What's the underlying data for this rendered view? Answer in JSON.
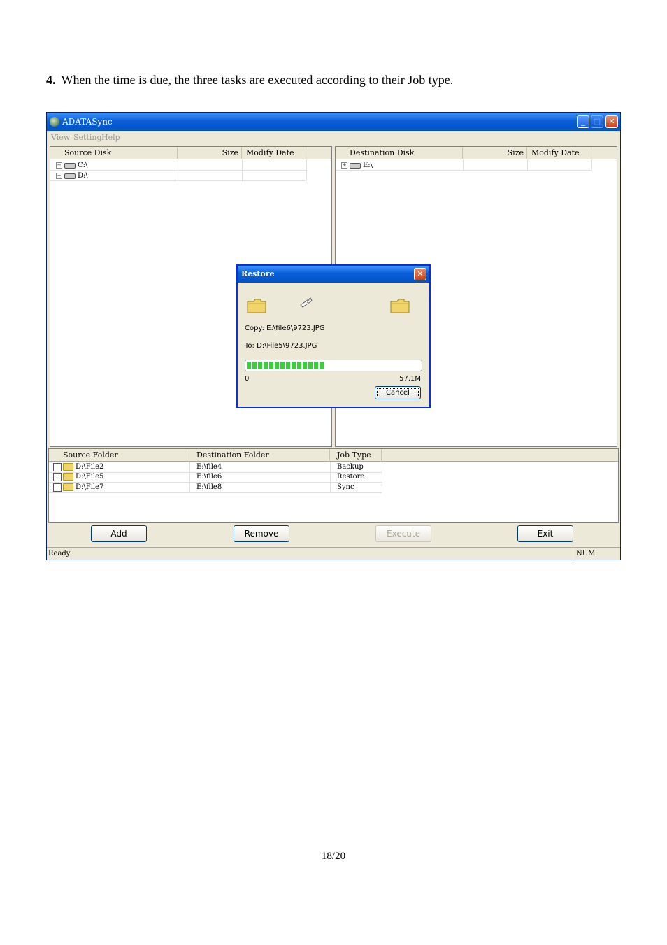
{
  "doc": {
    "step_number": "4.",
    "step_text": "When the time is due, the three tasks are executed according to their Job type.",
    "page_number": "18/20"
  },
  "window": {
    "title": "ADATASync",
    "menu": [
      "View",
      "Setting",
      "Help"
    ],
    "source_pane": {
      "columns": [
        "Source Disk",
        "Size",
        "Modify Date"
      ],
      "items": [
        "C:\\",
        "D:\\"
      ]
    },
    "dest_pane": {
      "columns": [
        "Destination Disk",
        "Size",
        "Modify Date"
      ],
      "items": [
        "E:\\"
      ]
    },
    "jobs": {
      "columns": [
        "Source Folder",
        "Destination Folder",
        "Job Type"
      ],
      "rows": [
        {
          "source": "D:\\File2",
          "dest": "E:\\file4",
          "type": "Backup"
        },
        {
          "source": "D:\\File5",
          "dest": "E:\\file6",
          "type": "Restore"
        },
        {
          "source": "D:\\File7",
          "dest": "E:\\file8",
          "type": "Sync"
        }
      ]
    },
    "buttons": {
      "add": "Add",
      "remove": "Remove",
      "execute": "Execute",
      "exit": "Exit"
    },
    "status": {
      "left": "Ready",
      "right": "NUM"
    }
  },
  "dialog": {
    "title": "Restore",
    "copy": "Copy: E:\\file6\\9723.JPG",
    "to": "To: D:\\File5\\9723.JPG",
    "progress_min": "0",
    "progress_max": "57.1M",
    "progress_fraction": 0.45,
    "cancel": "Cancel"
  },
  "colors": {
    "titlebar": "#0a5fd8",
    "progress": "#37d03b",
    "window_bg": "#ece9d8"
  }
}
